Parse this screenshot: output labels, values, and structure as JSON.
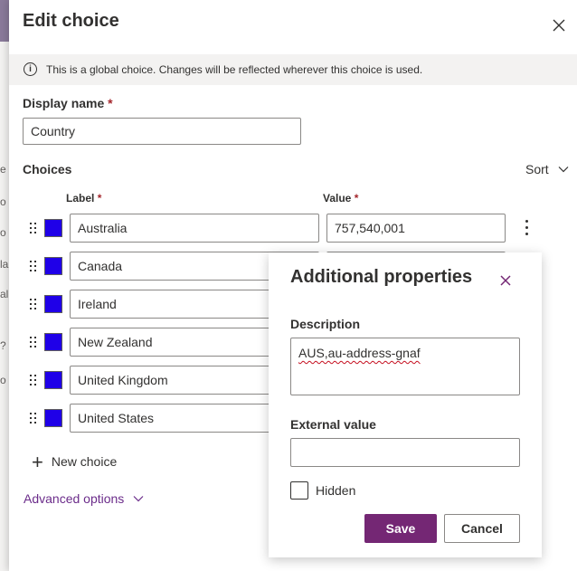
{
  "background": {
    "fragments": [
      "e",
      "o",
      "o",
      "la",
      "al",
      "?",
      "o"
    ]
  },
  "dialog": {
    "title": "Edit choice",
    "info_text": "This is a global choice. Changes will be reflected wherever this choice is used.",
    "display_name": {
      "label": "Display name",
      "required_mark": "*",
      "value": "Country"
    },
    "choices": {
      "heading": "Choices",
      "sort_label": "Sort",
      "label_header": "Label",
      "value_header": "Value",
      "required_mark": "*",
      "swatch_color": "#1f00e8",
      "items": [
        {
          "label": "Australia",
          "value": "757,540,001"
        },
        {
          "label": "Canada",
          "value": ""
        },
        {
          "label": "Ireland",
          "value": ""
        },
        {
          "label": "New Zealand",
          "value": ""
        },
        {
          "label": "United Kingdom",
          "value": ""
        },
        {
          "label": "United States",
          "value": ""
        }
      ],
      "new_choice_label": "New choice"
    },
    "advanced_options_label": "Advanced options"
  },
  "additional_properties": {
    "title": "Additional properties",
    "description_label": "Description",
    "description_value": "AUS,au-address-gnaf",
    "external_value_label": "External value",
    "external_value": "",
    "hidden_label": "Hidden",
    "hidden_checked": false,
    "save_label": "Save",
    "cancel_label": "Cancel"
  },
  "colors": {
    "accent": "#742774",
    "link": "#6b2c8a",
    "required": "#a4262c"
  }
}
